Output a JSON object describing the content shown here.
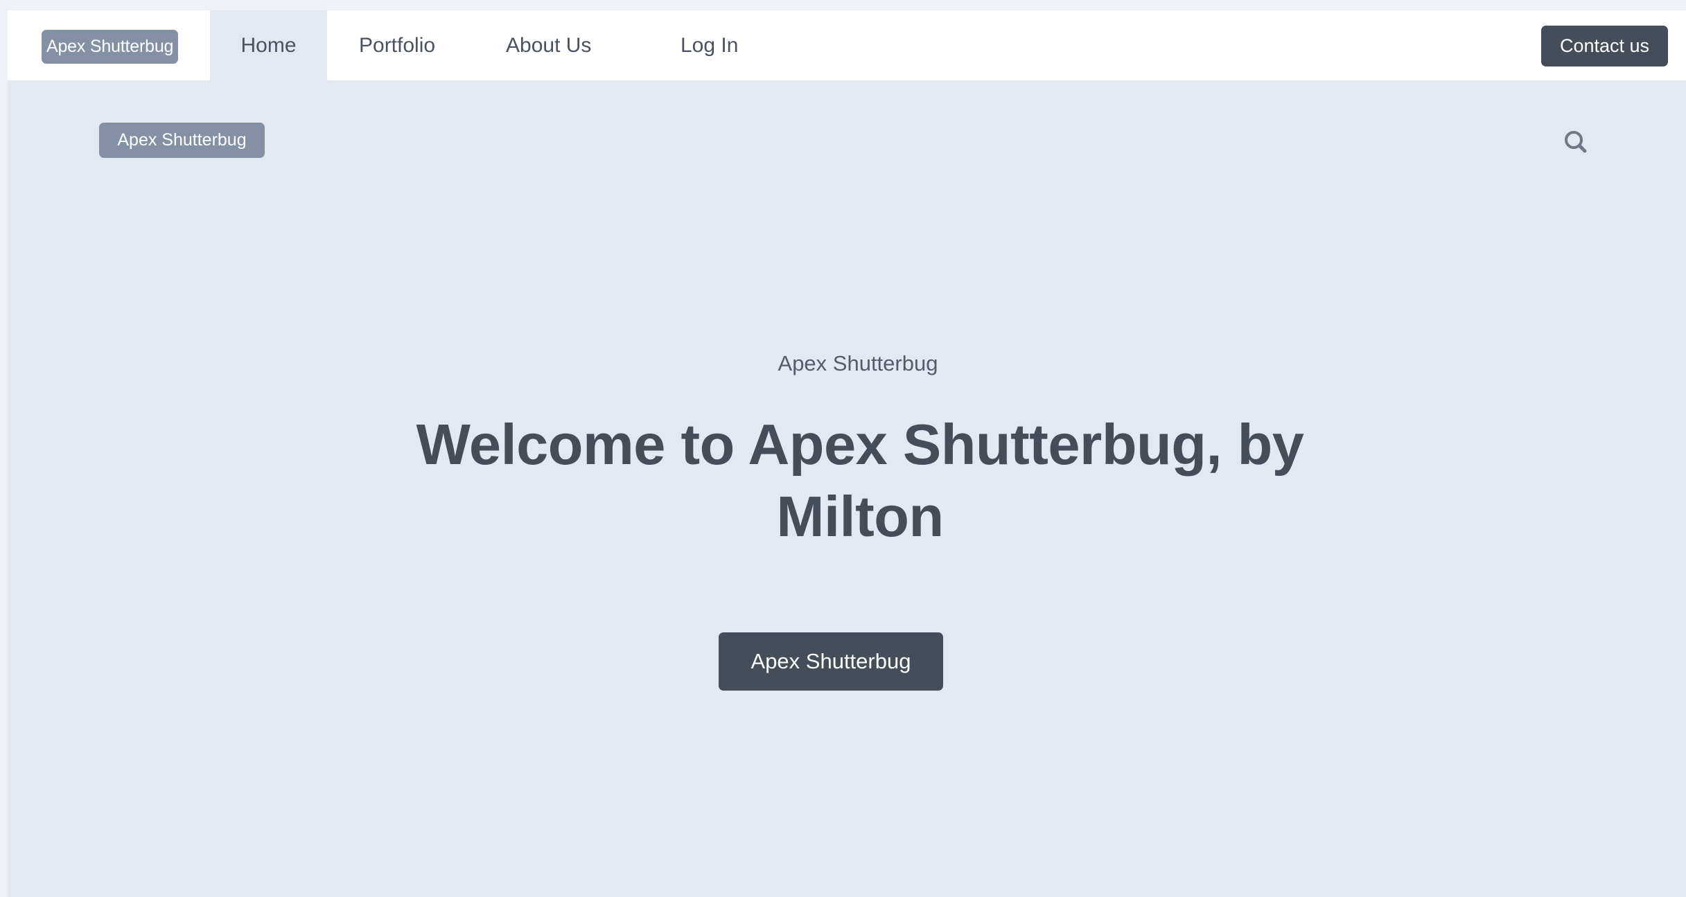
{
  "navbar": {
    "brand": "Apex Shutterbug",
    "items": [
      {
        "label": "Home",
        "active": true
      },
      {
        "label": "Portfolio",
        "active": false
      },
      {
        "label": "About Us",
        "active": false
      },
      {
        "label": "Log In",
        "active": false
      }
    ],
    "contact_label": "Contact us"
  },
  "subheader": {
    "brand": "Apex Shutterbug",
    "search_icon": "search-icon"
  },
  "hero": {
    "eyebrow": "Apex Shutterbug",
    "title": "Welcome to Apex Shutterbug, by Milton",
    "button_label": "Apex Shutterbug"
  },
  "colors": {
    "dark": "#454d59",
    "slate_badge": "#8390a6",
    "page_bg": "#e4e8f1",
    "nav_bg": "#ffffff"
  }
}
